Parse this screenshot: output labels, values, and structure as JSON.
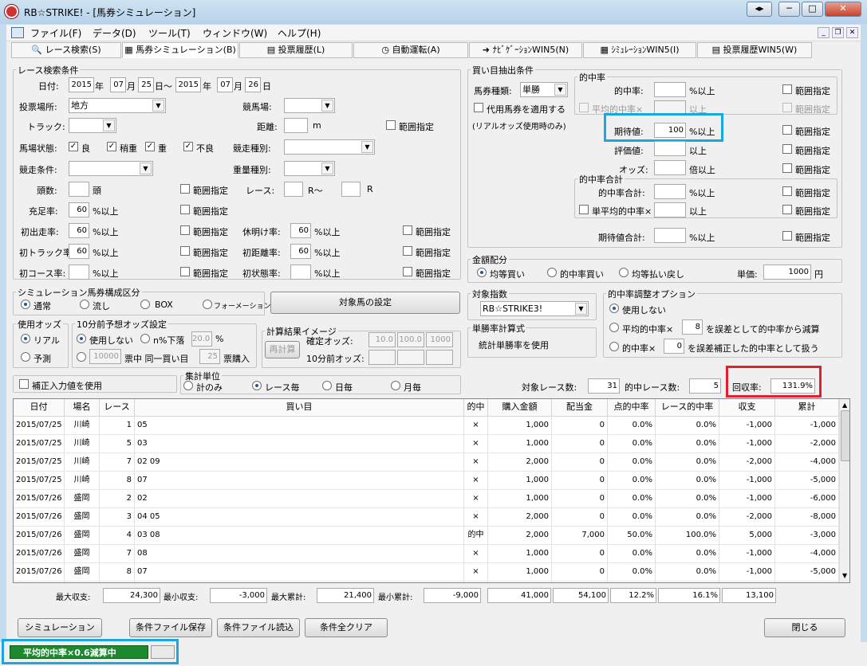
{
  "window": {
    "title": "RB☆STRIKE! - [馬券シミュレーション]",
    "controls": [
      "◂▸",
      "─",
      "□",
      "✕"
    ]
  },
  "menu": [
    "ファイル(F)",
    "データ(D)",
    "ツール(T)",
    "ウィンドウ(W)",
    "ヘルプ(H)"
  ],
  "tabs": [
    "レース検索(S)",
    "馬券シミュレーション(B)",
    "投票履歴(L)",
    "自動運転(A)",
    "ﾅﾋﾞｹﾞｰｼｮﾝWIN5(N)",
    "ｼﾐｭﾚｰｼｮﾝWIN5(I)",
    "投票履歴WIN5(W)"
  ],
  "race": {
    "title": "レース検索条件",
    "date_label": "日付:",
    "date_from": [
      "2015",
      "07",
      "25"
    ],
    "date_to": [
      "2015",
      "07",
      "26"
    ],
    "year": "年",
    "month": "月",
    "day": "日",
    "tilde": "日〜",
    "venue_label": "投票場所:",
    "venue": "地方",
    "course_label": "競馬場:",
    "track_label": "トラック:",
    "distance_label": "距離:",
    "distance_unit": "m",
    "range": "範囲指定",
    "baba_label": "馬場状態:",
    "baba": [
      "良",
      "稍重",
      "重",
      "不良"
    ],
    "kind_label": "競走種別:",
    "cond_label": "競走条件:",
    "weight_label": "重量種別:",
    "heads_label": "頭数:",
    "heads_unit": "頭",
    "race_label": "レース:",
    "race_r1": "R〜",
    "race_r2": "R",
    "fill_label": "充足率:",
    "fill": "60",
    "pct_up": "%以上",
    "first_label": "初出走率:",
    "first": "60",
    "rest_label": "休明け率:",
    "rest": "60",
    "trk_label": "初トラック率:",
    "trk": "60",
    "dist2_label": "初距離率:",
    "dist2": "60",
    "crs_label": "初コース率:",
    "state_label": "初状態率:"
  },
  "composition": {
    "title": "シミュレーション馬券構成区分",
    "options": [
      "通常",
      "流し",
      "BOX",
      "フォーメーション"
    ],
    "set_button": "対象馬の設定"
  },
  "odds": {
    "title": "使用オッズ",
    "options": [
      "リアル",
      "予測"
    ]
  },
  "pre10": {
    "title": "10分前予想オッズ設定",
    "unused": "使用しない",
    "drop": "n%下落",
    "drop_value": "20.0",
    "pct": "%",
    "yen_value": "10000",
    "yen_label": "票中 同一買い目",
    "count": "25",
    "buy": "票購入"
  },
  "calc": {
    "title": "計算結果イメージ",
    "button": "再計算",
    "fixed_label": "確定オッズ:",
    "pre_label": "10分前オッズ:",
    "vals": [
      "10.0",
      "100.0",
      "1000"
    ]
  },
  "correct": {
    "label": "補正入力値を使用"
  },
  "unit": {
    "title": "集計単位",
    "options": [
      "計のみ",
      "レース毎",
      "日毎",
      "月毎"
    ]
  },
  "extract": {
    "title": "買い目抽出条件",
    "type_label": "馬券種類:",
    "type": "単勝",
    "sub_label": "代用馬券を適用する",
    "real_note": "(リアルオッズ使用時のみ)",
    "hit_title": "的中率",
    "hit_label": "的中率:",
    "pct_up": "%以上",
    "avg_hit": "平均的中率×",
    "ijo": "以上",
    "exp_label": "期待値:",
    "exp": "100",
    "eval_label": "評価値:",
    "odds_label": "オッズ:",
    "bai": "倍以上",
    "sum_title": "的中率合計",
    "sum_label": "的中率合計:",
    "single_avg": "単平均的中率×",
    "exp_sum_label": "期待値合計:",
    "range": "範囲指定"
  },
  "amount": {
    "title": "金額配分",
    "options": [
      "均等買い",
      "的中率買い",
      "均等払い戻し"
    ],
    "unit_label": "単価:",
    "unit_value": "1000",
    "yen": "円"
  },
  "index": {
    "title": "対象指数",
    "value": "RB☆STRIKE3!"
  },
  "single_calc": {
    "title": "単勝率計算式",
    "value": "統計単勝率を使用"
  },
  "adjust": {
    "title": "的中率調整オプション",
    "unused": "使用しない",
    "opt2_a": "平均的中率×",
    "opt2_val": "8",
    "opt2_b": "を誤差として的中率から減算",
    "opt3_a": "的中率×",
    "opt3_val": "0",
    "opt3_b": "を誤差補正した的中率として扱う"
  },
  "summary": {
    "races_label": "対象レース数:",
    "races": "31",
    "hits_label": "的中レース数:",
    "hits": "5",
    "return_label": "回収率:",
    "return": "131.9%"
  },
  "table": {
    "headers": [
      "日付",
      "場名",
      "レース",
      "買い目",
      "的中",
      "購入金額",
      "配当金",
      "点的中率",
      "レース的中率",
      "収支",
      "累計"
    ],
    "rows": [
      [
        "2015/07/25",
        "川崎",
        "1",
        "05",
        "×",
        "1,000",
        "0",
        "0.0%",
        "0.0%",
        "-1,000",
        "-1,000"
      ],
      [
        "2015/07/25",
        "川崎",
        "5",
        "03",
        "×",
        "1,000",
        "0",
        "0.0%",
        "0.0%",
        "-1,000",
        "-2,000"
      ],
      [
        "2015/07/25",
        "川崎",
        "7",
        "02 09",
        "×",
        "2,000",
        "0",
        "0.0%",
        "0.0%",
        "-2,000",
        "-4,000"
      ],
      [
        "2015/07/25",
        "川崎",
        "8",
        "07",
        "×",
        "1,000",
        "0",
        "0.0%",
        "0.0%",
        "-1,000",
        "-5,000"
      ],
      [
        "2015/07/26",
        "盛岡",
        "2",
        "02",
        "×",
        "1,000",
        "0",
        "0.0%",
        "0.0%",
        "-1,000",
        "-6,000"
      ],
      [
        "2015/07/26",
        "盛岡",
        "3",
        "04 05",
        "×",
        "2,000",
        "0",
        "0.0%",
        "0.0%",
        "-2,000",
        "-8,000"
      ],
      [
        "2015/07/26",
        "盛岡",
        "4",
        "03 08",
        "的中",
        "2,000",
        "7,000",
        "50.0%",
        "100.0%",
        "5,000",
        "-3,000"
      ],
      [
        "2015/07/26",
        "盛岡",
        "7",
        "08",
        "×",
        "1,000",
        "0",
        "0.0%",
        "0.0%",
        "-1,000",
        "-4,000"
      ],
      [
        "2015/07/26",
        "盛岡",
        "8",
        "07",
        "×",
        "1,000",
        "0",
        "0.0%",
        "0.0%",
        "-1,000",
        "-5,000"
      ],
      [
        "2015/07/26",
        "盛岡",
        "10",
        "09",
        "×",
        "1,000",
        "0",
        "0.0%",
        "0.0%",
        "-1,000",
        "-6,000"
      ]
    ]
  },
  "totals": {
    "max_income_label": "最大収支:",
    "max_income": "24,300",
    "min_income_label": "最小収支:",
    "min_income": "-3,000",
    "max_cum_label": "最大累計:",
    "max_cum": "21,400",
    "min_cum_label": "最小累計:",
    "min_cum": "-9,000",
    "buy": "41,000",
    "pay": "54,100",
    "pt": "12.2%",
    "race": "16.1%",
    "inc": "13,100"
  },
  "buttons": {
    "sim": "シミュレーション",
    "save": "条件ファイル保存",
    "load": "条件ファイル読込",
    "clear": "条件全クリア",
    "close": "閉じる"
  },
  "status": {
    "text": "平均的中率×0.6減算中"
  }
}
